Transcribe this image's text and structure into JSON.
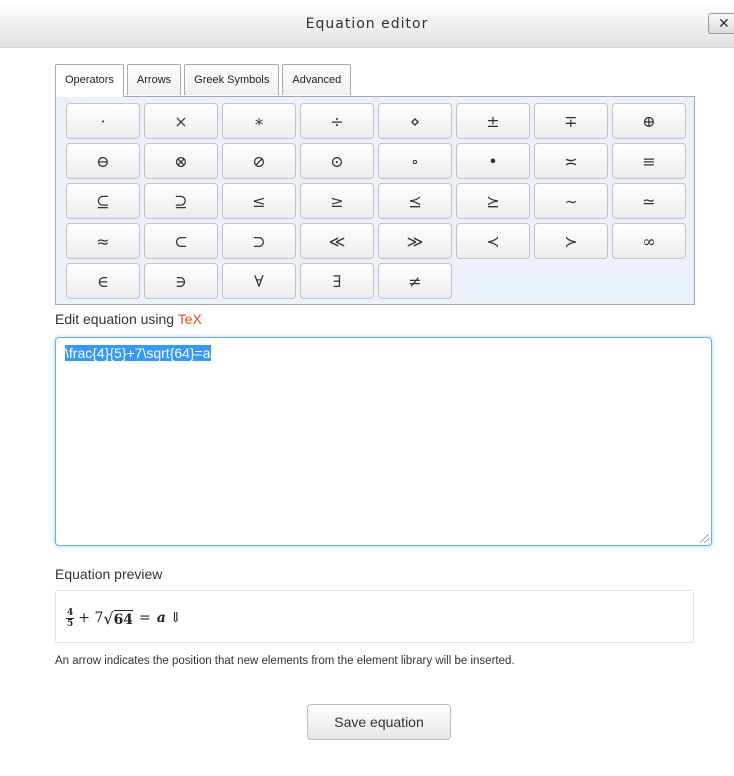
{
  "window": {
    "title": "Equation editor",
    "close_label": "✕"
  },
  "tabs": [
    {
      "label": "Operators",
      "active": true
    },
    {
      "label": "Arrows",
      "active": false
    },
    {
      "label": "Greek Symbols",
      "active": false
    },
    {
      "label": "Advanced",
      "active": false
    }
  ],
  "symbols": [
    "·",
    "×",
    "∗",
    "÷",
    "⋄",
    "±",
    "∓",
    "⊕",
    "⊖",
    "⊗",
    "⊘",
    "⊙",
    "∘",
    "•",
    "≍",
    "≡",
    "⊆",
    "⊇",
    "≤",
    "≥",
    "⪯",
    "⪰",
    "∼",
    "≃",
    "≈",
    "⊂",
    "⊃",
    "≪",
    "≫",
    "≺",
    "≻",
    "∞",
    "∈",
    "∋",
    "∀",
    "∃",
    "≠"
  ],
  "editor": {
    "label_prefix": "Edit equation using ",
    "label_link": "TeX",
    "value": "\\frac{4}{5}+7\\sqrt{64}=a"
  },
  "preview": {
    "label": "Equation preview",
    "frac_num": "4",
    "frac_den": "5",
    "plus_term": "+ 7",
    "radicand": "64",
    "equals": "=",
    "variable": "a",
    "cursor_arrow": "⇓"
  },
  "help_text": "An arrow indicates the position that new elements from the element library will be inserted.",
  "save_label": "Save equation"
}
